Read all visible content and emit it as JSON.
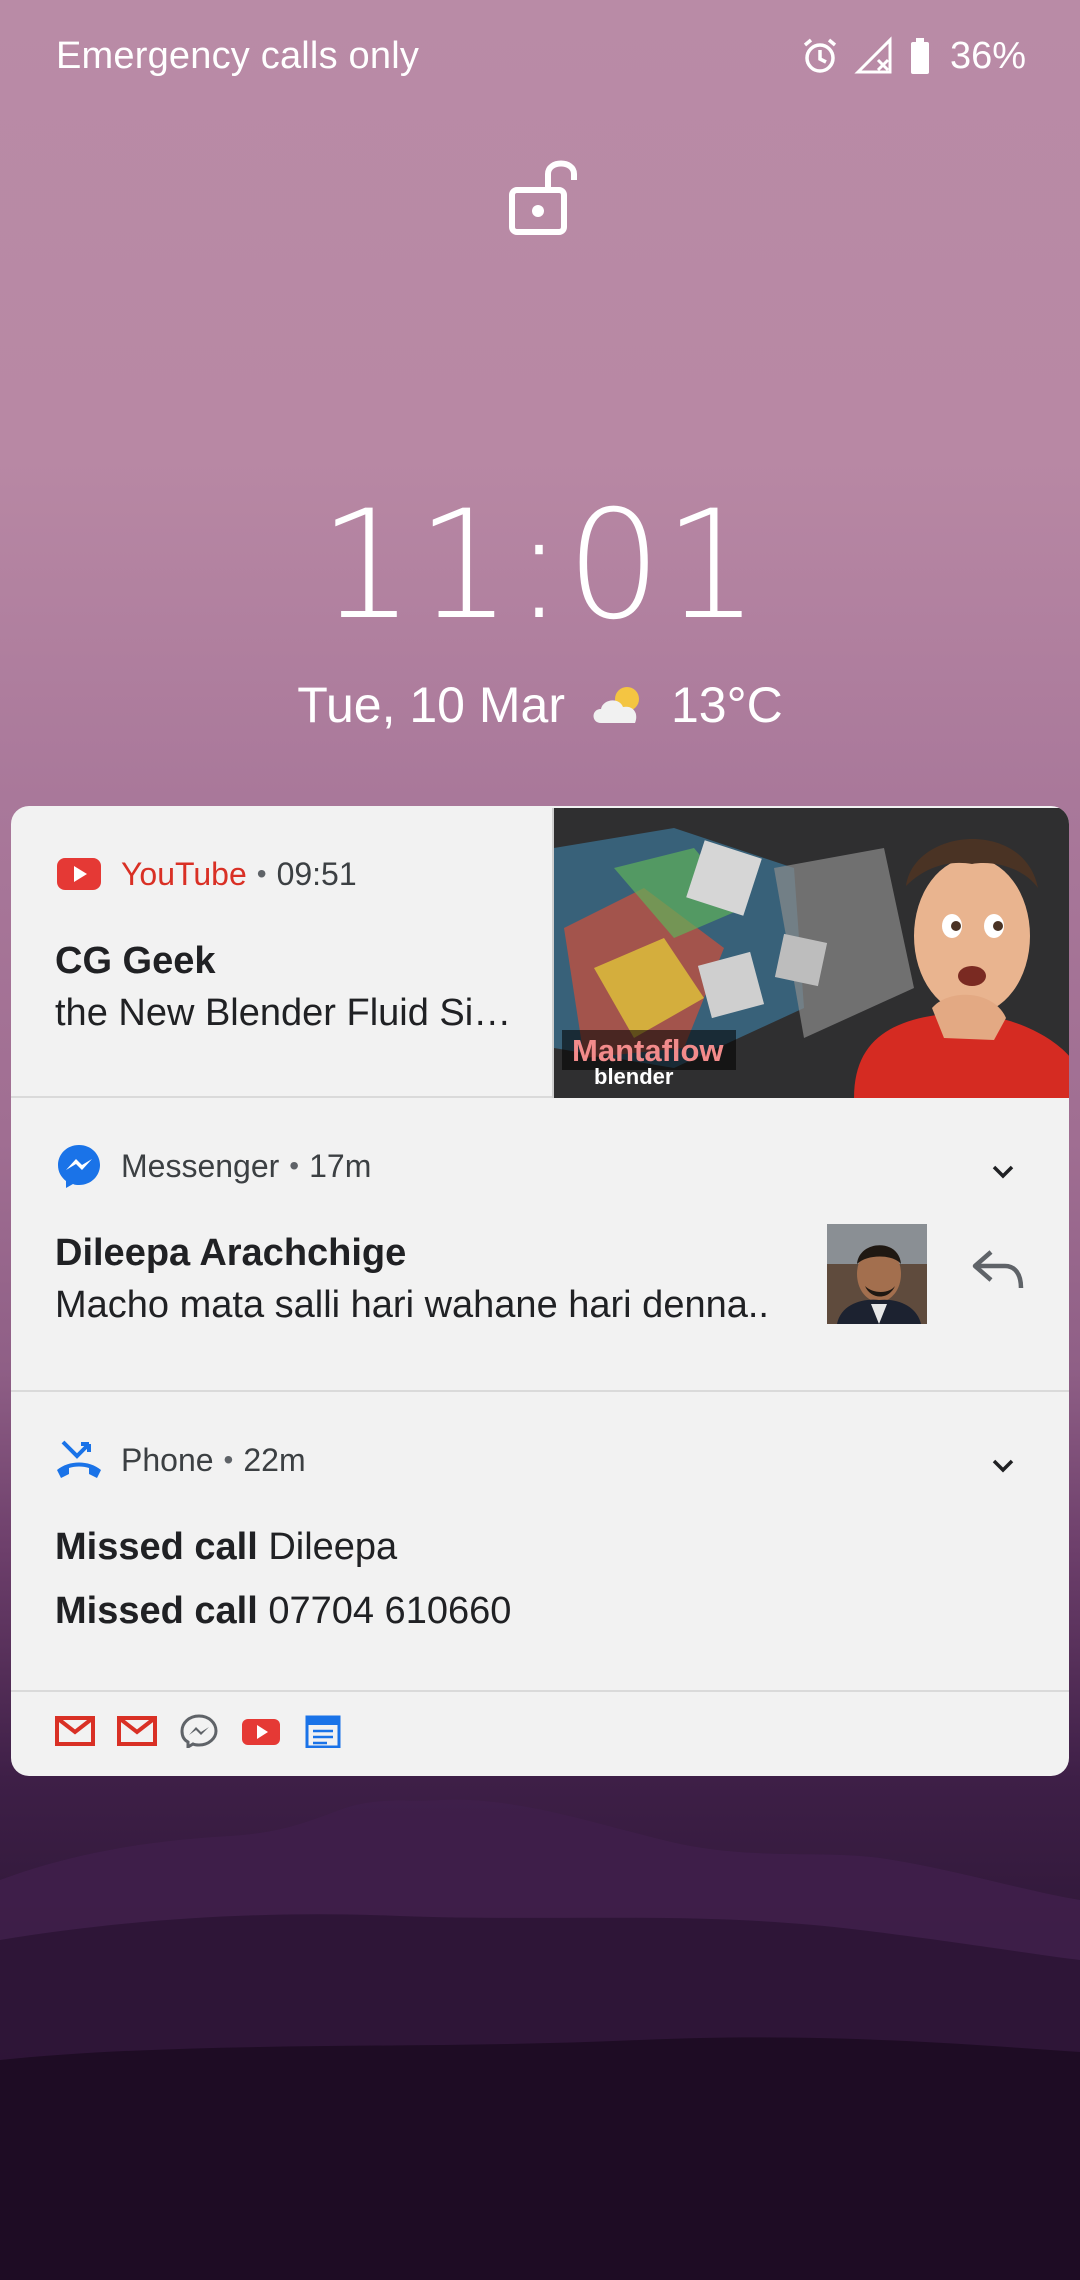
{
  "status_bar": {
    "carrier_text": "Emergency calls only",
    "icons": [
      "alarm-icon",
      "no-signal-icon",
      "battery-icon"
    ],
    "battery_percent": "36%"
  },
  "lock_screen": {
    "lock_icon": "unlock-icon",
    "time": "11:01",
    "date": "Tue, 10 Mar",
    "weather_icon": "partly-cloudy-icon",
    "temperature": "13°C"
  },
  "notifications": [
    {
      "app": "YouTube",
      "app_icon": "youtube-icon",
      "time": "09:51",
      "title": "CG Geek",
      "text": "the New Blender Fluid Si…",
      "thumbnail_text": "Mantaflow",
      "thumbnail_subtext": "blender"
    },
    {
      "app": "Messenger",
      "app_icon": "messenger-icon",
      "time": "17m",
      "title": "Dileepa Arachchige",
      "text": "Macho mata salli hari wahane hari denna..",
      "action_icon": "reply-icon"
    },
    {
      "app": "Phone",
      "app_icon": "missed-call-icon",
      "time": "22m",
      "lines": [
        {
          "label": "Missed call",
          "value": "Dileepa"
        },
        {
          "label": "Missed call",
          "value": "07704 610660"
        }
      ]
    }
  ],
  "notification_shelf": {
    "icons": [
      "gmail-icon",
      "gmail-icon",
      "messenger-icon",
      "youtube-icon",
      "calendar-icon"
    ]
  },
  "colors": {
    "youtube_red": "#d93025",
    "messenger_blue": "#1a73e8",
    "card_background": "#f2f2f2"
  }
}
